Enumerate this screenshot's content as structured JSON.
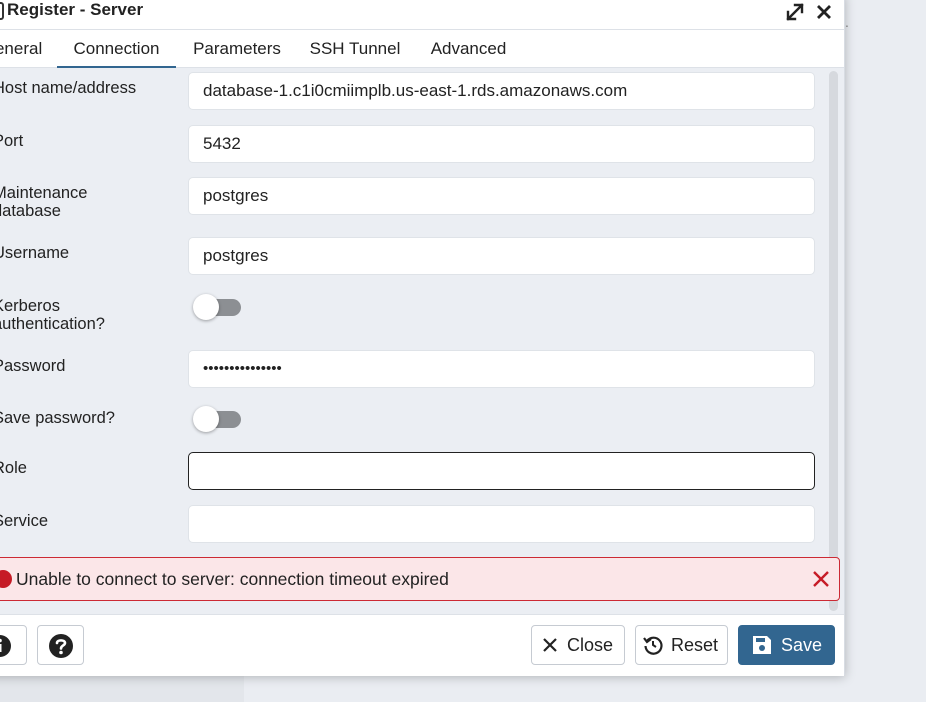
{
  "dialog": {
    "title": "Register - Server"
  },
  "tabs": [
    {
      "label": "General"
    },
    {
      "label": "Connection"
    },
    {
      "label": "Parameters"
    },
    {
      "label": "SSH Tunnel"
    },
    {
      "label": "Advanced"
    }
  ],
  "active_tab": "Connection",
  "form": {
    "host": {
      "label": "Host name/address",
      "value": "database-1.c1i0cmiimplb.us-east-1.rds.amazonaws.com"
    },
    "port": {
      "label": "Port",
      "value": "5432"
    },
    "maintenance_db": {
      "label_line1": "Maintenance",
      "label_line2": "database",
      "value": "postgres"
    },
    "username": {
      "label": "Username",
      "value": "postgres"
    },
    "kerberos": {
      "label_line1": "Kerberos",
      "label_line2": "authentication?",
      "state": "off"
    },
    "password": {
      "label": "Password",
      "value": "•••••••••••••••"
    },
    "save_password": {
      "label": "Save password?",
      "state": "off"
    },
    "role": {
      "label": "Role",
      "value": ""
    },
    "service": {
      "label": "Service",
      "value": ""
    }
  },
  "error": {
    "message": "Unable to connect to server: connection timeout expired"
  },
  "footer": {
    "close_label": "Close",
    "reset_label": "Reset",
    "save_label": "Save"
  },
  "colors": {
    "accent": "#326690",
    "error_border": "#cc2a34",
    "error_bg": "#fbe6e8",
    "error_icon": "#c61b26"
  },
  "icons": [
    "server-icon",
    "maximize-icon",
    "close-icon",
    "error-icon",
    "dismiss-icon",
    "info-icon",
    "help-icon",
    "close-x-icon",
    "reset-icon",
    "save-icon"
  ]
}
